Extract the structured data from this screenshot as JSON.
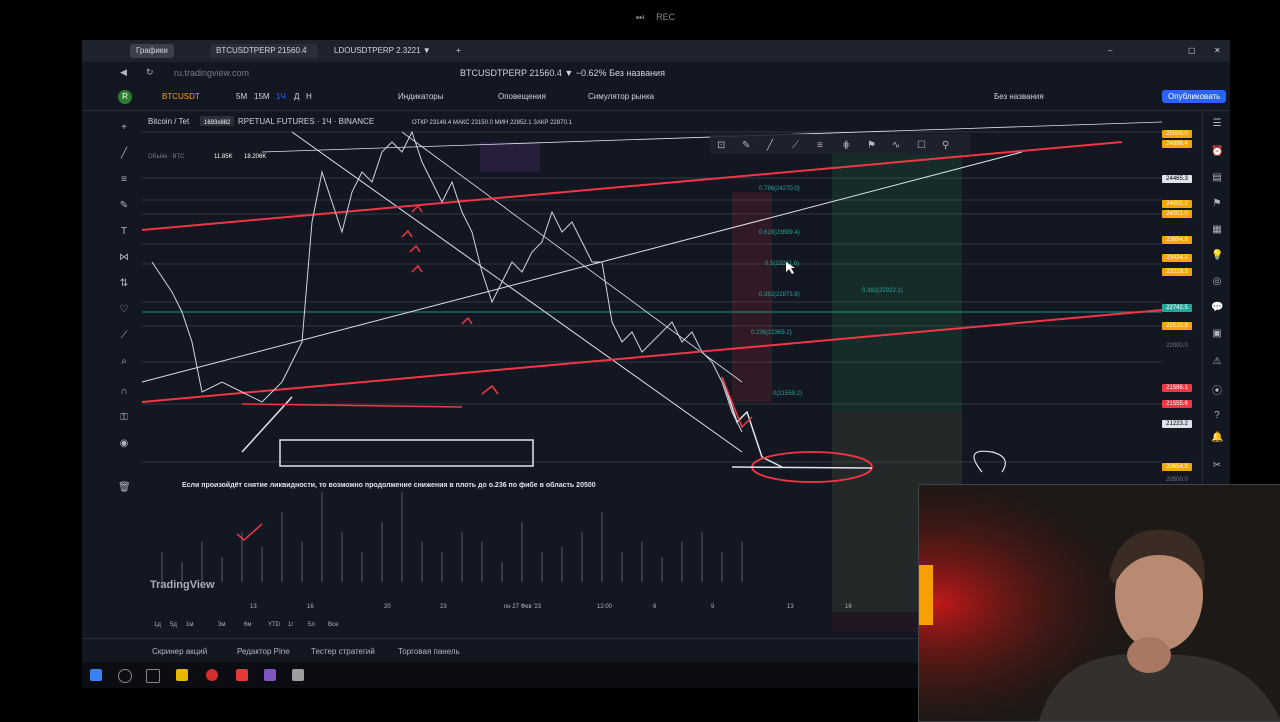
{
  "media": {
    "icon1": "⏭",
    "label": "REC"
  },
  "browser": {
    "tabs": [
      {
        "label": "Графики",
        "active": false
      },
      {
        "label": "BTCUSDTPERP 21560.4",
        "active": true
      },
      {
        "label": "LDOUSDTPERP 2.3221 ▼",
        "active": false
      }
    ],
    "url": "ru.tradingview.com",
    "window_title": "BTCUSDTPERP 21560.4 ▼ −0.62% Без названия"
  },
  "toolbar": {
    "symbol": "BTCUSDT",
    "intervals": [
      "5M",
      "15M",
      "1Ч",
      "Д",
      "Н"
    ],
    "indicators_label": "Индикаторы",
    "alerts_label": "Оповещения",
    "replay_label": "Симулятор рынка",
    "layout_name": "Без названия",
    "publish_label": "Опубликовать",
    "currency": "USDT"
  },
  "chart": {
    "symbol_title": "Bitcoin / Tet",
    "exchange_title": "RPETUAL FUTURES · 1Ч · BINANCE",
    "dims_badge": "1693x882",
    "ohlc": "ОТКР 23148.4  МАКС 23150.0  МИН 22852.1  ЗАКР 22870.1",
    "volume_label": "Объём · BTC",
    "volume_value": "11.85K",
    "volume_value2": "18.206K",
    "fib_levels": [
      {
        "label": "0.786(24270.0)"
      },
      {
        "label": "0.618(23689.4)"
      },
      {
        "label": "0.5(23281.6)"
      },
      {
        "label": "0.382(22873.8)"
      },
      {
        "label": "0.236(22369.2)"
      },
      {
        "label": "0(21559.2)"
      }
    ],
    "fib_right": "0.382(22922.1)",
    "note": "Если произойдёт снятие ликвидности, то возможно продолжение снижения в плоть до о.236 по фибе в область 20500",
    "watermark": "TradingView",
    "x_labels": [
      "13",
      "16",
      "20",
      "23",
      "пн 27 Фев '23",
      "12:00",
      "6",
      "9",
      "13",
      "16"
    ],
    "timeframes": [
      "1д",
      "5д",
      "1м",
      "3м",
      "6м",
      "YTD",
      "1г",
      "5л",
      "Все"
    ]
  },
  "price_labels": [
    {
      "text": "25000.0",
      "bg": "#f7a600"
    },
    {
      "text": "24896.4",
      "bg": "#f7a600"
    },
    {
      "text": "24465.3",
      "bg": "#e0e3eb",
      "fg": "#000"
    },
    {
      "text": "24002.2",
      "bg": "#f7a600"
    },
    {
      "text": "24001.0",
      "bg": "#f7a600"
    },
    {
      "text": "23654.8",
      "bg": "#f7a600"
    },
    {
      "text": "23424.2",
      "bg": "#f7a600"
    },
    {
      "text": "23219.3",
      "bg": "#f7a600"
    },
    {
      "text": "22742.5",
      "bg": "#26a69a"
    },
    {
      "text": "22510.8",
      "bg": "#f7a600"
    },
    {
      "text": "22000.0",
      "bg": "#131722",
      "fg": "#787b86"
    },
    {
      "text": "21586.1",
      "bg": "#f23645"
    },
    {
      "text": "21555.6",
      "bg": "#f23645"
    },
    {
      "text": "21223.2",
      "bg": "#e0e3eb",
      "fg": "#000"
    },
    {
      "text": "20654.9",
      "bg": "#f7a600"
    },
    {
      "text": "20500.0",
      "bg": "#131722",
      "fg": "#787b86"
    }
  ],
  "bottom_panel": {
    "tabs": [
      "Скринер акций",
      "Редактор Pine",
      "Тестер стратегий",
      "Торговая панель"
    ]
  },
  "colors": {
    "bg": "#131722",
    "red": "#f23645",
    "white": "#e0e3eb",
    "green": "#26a69a",
    "accent": "#2962ff"
  }
}
